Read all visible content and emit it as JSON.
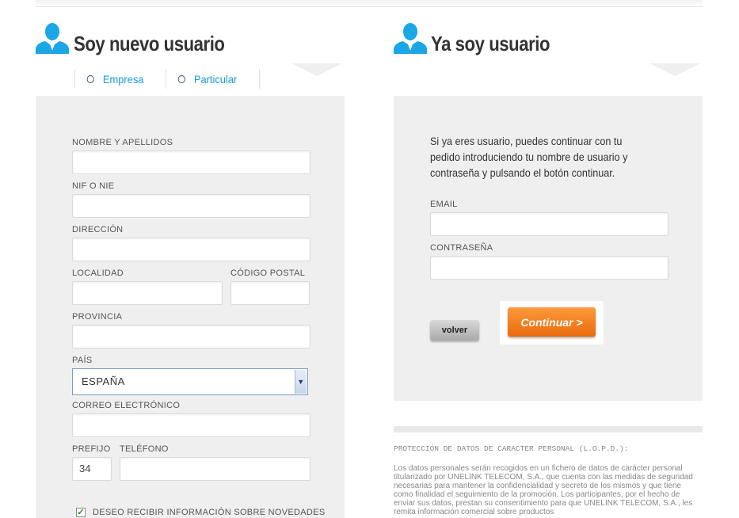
{
  "new_user": {
    "title": "Soy nuevo usuario",
    "radio_options": [
      "Empresa",
      "Particular"
    ],
    "fields": {
      "nombre": {
        "label": "NOMBRE Y APELLIDOS",
        "value": ""
      },
      "nif": {
        "label": "NIF O NIE",
        "value": ""
      },
      "direccion": {
        "label": "DIRECCIÓN",
        "value": ""
      },
      "localidad": {
        "label": "LOCALIDAD",
        "value": ""
      },
      "codigo_postal": {
        "label": "CÓDIGO POSTAL",
        "value": ""
      },
      "provincia": {
        "label": "PROVINCIA",
        "value": ""
      },
      "pais": {
        "label": "PAÍS",
        "value": "ESPAÑA"
      },
      "correo": {
        "label": "CORREO ELECTRÓNICO",
        "value": ""
      },
      "prefijo": {
        "label": "PREFIJO",
        "value": "34"
      },
      "telefono": {
        "label": "TELÉFONO",
        "value": ""
      }
    },
    "newsletter_label": "DESEO RECIBIR INFORMACIÓN SOBRE NOVEDADES",
    "newsletter_checked": true
  },
  "existing_user": {
    "title": "Ya soy usuario",
    "intro": "Si ya eres usuario, puedes continuar con tu pedido introduciendo tu nombre de usuario y contraseña y pulsando el botón continuar.",
    "fields": {
      "email": {
        "label": "EMAIL",
        "value": ""
      },
      "password": {
        "label": "CONTRASEÑA",
        "value": ""
      }
    },
    "back_button": "volver",
    "continue_button": "Continuar >"
  },
  "lopd": {
    "title": "PROTECCIÓN DE DATOS DE CARACTER PERSONAL (L.O.P.D.):",
    "text": "Los datos personales serán recogidos en un fichero de datos de carácter personal titularizado por UNELINK TELECOM, S.A., que cuenta con las medidas de seguridad necesarias para mantener la confidencialidad y secreto de los mismos y que tiene como finalidad el seguimiento de la promoción. Los participantes, por el hecho de enviar sus datos, prestan su consentimiento para que UNELINK TELECOM, S.A., les remita información comercial sobre productos"
  },
  "colors": {
    "accent_blue": "#1a9ad8",
    "panel_gray": "#efefef",
    "orange": "#ee7215"
  },
  "icons": {
    "user": "user-icon",
    "select_arrow": "chevron-down-icon",
    "check": "check-icon"
  }
}
